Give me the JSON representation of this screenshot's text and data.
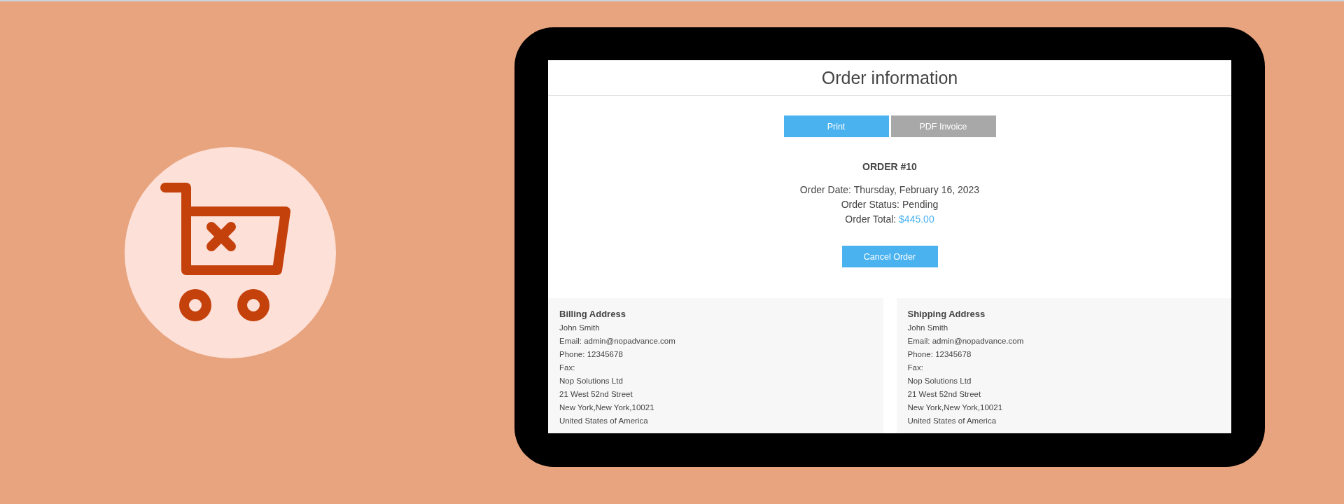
{
  "page": {
    "title": "Order information"
  },
  "actions": [
    {
      "label": "Print",
      "kind": "primary"
    },
    {
      "label": "PDF Invoice",
      "kind": "secondary"
    }
  ],
  "order": {
    "number": "ORDER #10",
    "date": "Order Date: Thursday, February 16, 2023",
    "status": "Order Status: Pending",
    "total_label": "Order Total:",
    "total_value": "$445.00"
  },
  "cancel_button": {
    "label": "Cancel Order"
  },
  "addresses": [
    {
      "title": "Billing Address",
      "lines": [
        "John Smith",
        "Email: admin@nopadvance.com",
        "Phone: 12345678",
        "Fax:",
        "Nop Solutions Ltd",
        "21 West 52nd Street",
        "New York,New York,10021",
        "United States of America"
      ]
    },
    {
      "title": "Shipping Address",
      "lines": [
        "John Smith",
        "Email: admin@nopadvance.com",
        "Phone: 12345678",
        "Fax:",
        "Nop Solutions Ltd",
        "21 West 52nd Street",
        "New York,New York,10021",
        "United States of America"
      ]
    }
  ]
}
